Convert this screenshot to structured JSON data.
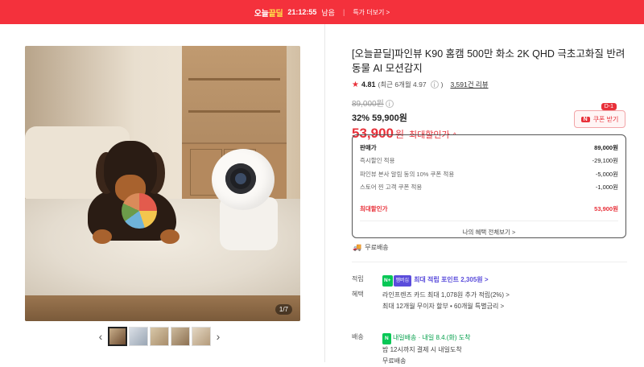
{
  "banner": {
    "badge_a": "오늘",
    "badge_b": "끝딜",
    "time": "21:12:55",
    "time_suffix": "남음",
    "sep": "|",
    "more": "특가 더보기 >"
  },
  "gallery": {
    "counter": "1/7",
    "prev": "‹",
    "next": "›",
    "thumbnails": [
      "thumb-1",
      "thumb-2",
      "thumb-3",
      "thumb-4",
      "thumb-5"
    ],
    "selected_index": 0
  },
  "product": {
    "title": "[오늘끝딜]파인뷰 K90 홈캠 500만 화소 2K QHD 극초고화질 반려동물 AI 모션감지",
    "rating": "4.81",
    "rating_recent": "(최근 6개월 4.97",
    "rating_recent_close": ")",
    "info_icon": "i",
    "review_count": "3,591건 리뷰",
    "original_price": "89,000원",
    "discount_text": "32% 59,900원",
    "final_price": "53,900",
    "final_won": "원",
    "final_label": "최대할인가",
    "final_caret": "^"
  },
  "coupon": {
    "dday": "D-1",
    "logo": "N",
    "label": "쿠폰 받기"
  },
  "price_breakdown": {
    "rows": [
      {
        "label": "판매가",
        "value": "89,000원"
      },
      {
        "label": "즉시할인 적용",
        "value": "-29,100원"
      },
      {
        "label": "파인뷰 본사 알림 동의 10% 쿠폰 적용",
        "value": "-5,000원"
      },
      {
        "label": "스토어 찐 고객 쿠폰 적용",
        "value": "-1,000원"
      }
    ],
    "total_label": "최대할인가",
    "total_value": "53,900원",
    "view_all": "나의 혜택 전체보기 >"
  },
  "shipping": {
    "icon": "🚚",
    "label": "무료배송"
  },
  "points": {
    "key": "적립",
    "npay": "N+",
    "plus": "멤버십",
    "text": "최대 적립 포인트 2,305원 >"
  },
  "benefits": {
    "key": "혜택",
    "line1": "라인프렌즈 카드 최대 1,078원 추가 적립(2%) >",
    "line2": "최대 12개월 무이자 할부 • 60개월 특별금리 >"
  },
  "delivery": {
    "key": "배송",
    "logo": "N",
    "badge_text": "내일배송",
    "arrival": "· 내일 8.4.(화) 도착",
    "note": "밤 12시까지 결제 시 내일도착",
    "free": "무료배송"
  },
  "colors": {
    "accent": "#f4313c",
    "price_red": "#e8313a",
    "npay_green": "#06c755",
    "membership_violet": "#5a4cdb"
  }
}
